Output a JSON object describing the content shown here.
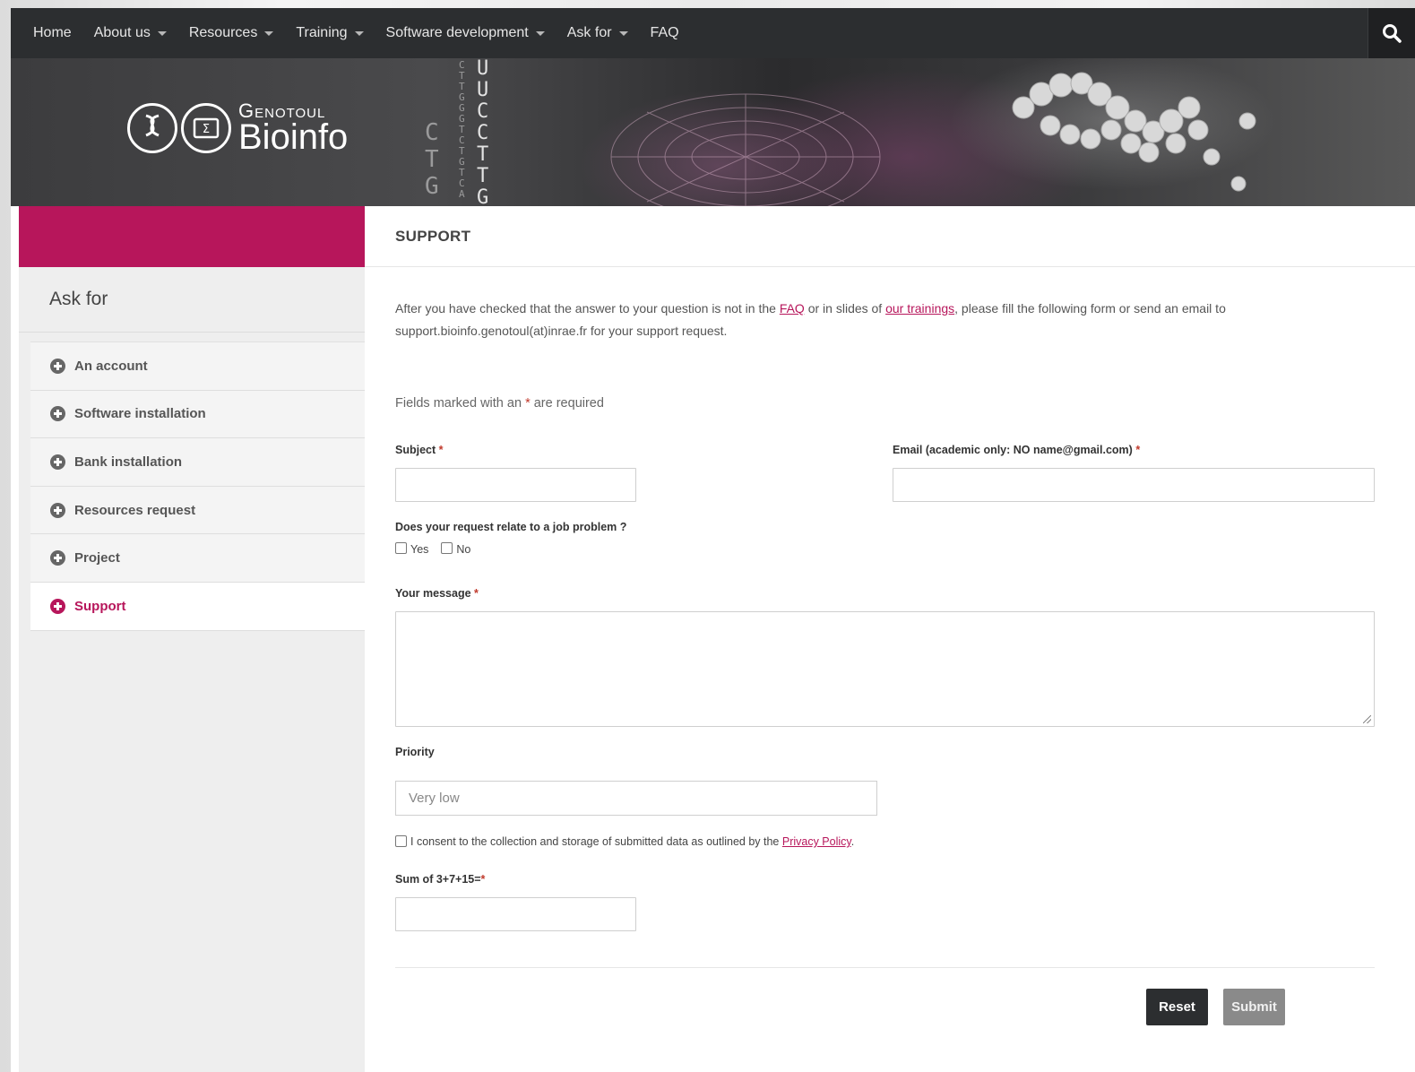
{
  "nav": {
    "items": [
      {
        "label": "Home",
        "dropdown": false
      },
      {
        "label": "About us",
        "dropdown": true
      },
      {
        "label": "Resources",
        "dropdown": true
      },
      {
        "label": "Training",
        "dropdown": true
      },
      {
        "label": "Software development",
        "dropdown": true
      },
      {
        "label": "Ask for",
        "dropdown": true
      },
      {
        "label": "FAQ",
        "dropdown": false
      }
    ],
    "search_icon": "search-icon"
  },
  "banner": {
    "logo_top": "Genotoul",
    "logo_bottom": "Bioinfo",
    "logo_icons": [
      "dna-helix-icon",
      "sigma-screen-icon"
    ]
  },
  "sidebar": {
    "title": "Ask for",
    "items": [
      {
        "label": "An account",
        "active": false
      },
      {
        "label": "Software installation",
        "active": false
      },
      {
        "label": "Bank installation",
        "active": false
      },
      {
        "label": "Resources request",
        "active": false
      },
      {
        "label": "Project",
        "active": false
      },
      {
        "label": "Support",
        "active": true
      }
    ]
  },
  "main": {
    "title": "SUPPORT",
    "intro": {
      "part1": "After you have checked that the answer to your question is not in the ",
      "faq_link": "FAQ",
      "part2": " or in slides of ",
      "trainings_link": "our trainings",
      "part3": ", please fill the following form or send an email to support.bioinfo.genotoul(at)inrae.fr for your support request."
    },
    "required_note_before": "Fields marked with an ",
    "required_note_star": "*",
    "required_note_after": " are required",
    "form": {
      "subject_label": "Subject",
      "subject_value": "",
      "email_label": "Email (academic only: NO name@gmail.com)",
      "email_value": "",
      "job_problem_label": "Does your request relate to a job problem ?",
      "job_options": [
        {
          "label": "Yes",
          "checked": false
        },
        {
          "label": "No",
          "checked": false
        }
      ],
      "message_label": "Your message",
      "message_value": "",
      "priority_label": "Priority",
      "priority_selected": "Very low",
      "consent_text": "I consent to the collection and storage of submitted data as outlined by the ",
      "consent_link": "Privacy Policy",
      "consent_end": ".",
      "consent_checked": false,
      "captcha_label": "Sum of 3+7+15=",
      "captcha_value": "",
      "required_star": "*"
    },
    "buttons": {
      "reset": "Reset",
      "submit": "Submit"
    }
  },
  "colors": {
    "accent": "#b7165b",
    "nav_bg": "#2c2e30",
    "required": "#c0392b"
  }
}
